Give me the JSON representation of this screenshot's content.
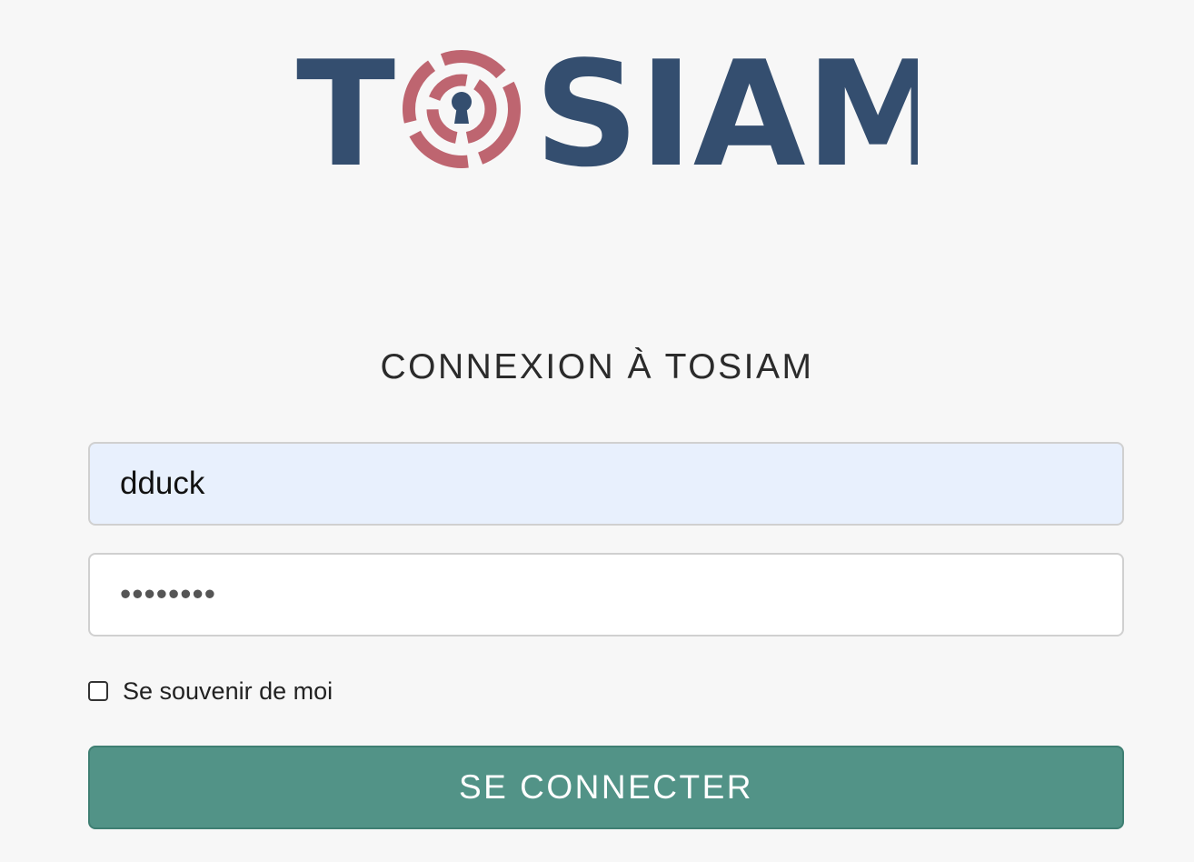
{
  "logo": {
    "text_before": "T",
    "text_after": "SIAM",
    "colors": {
      "navy": "#344e6f",
      "rose": "#be6570"
    },
    "icon": "keyhole-ring-icon"
  },
  "login": {
    "heading": "CONNEXION À TOSIAM",
    "username_value": "dduck",
    "password_value": "••••••••",
    "remember_label": "Se souvenir de moi",
    "remember_checked": false,
    "submit_label": "SE CONNECTER"
  },
  "colors": {
    "background": "#f7f7f7",
    "username_bg": "#e8f0fd",
    "button": "#529387",
    "button_text": "#ffffff"
  }
}
